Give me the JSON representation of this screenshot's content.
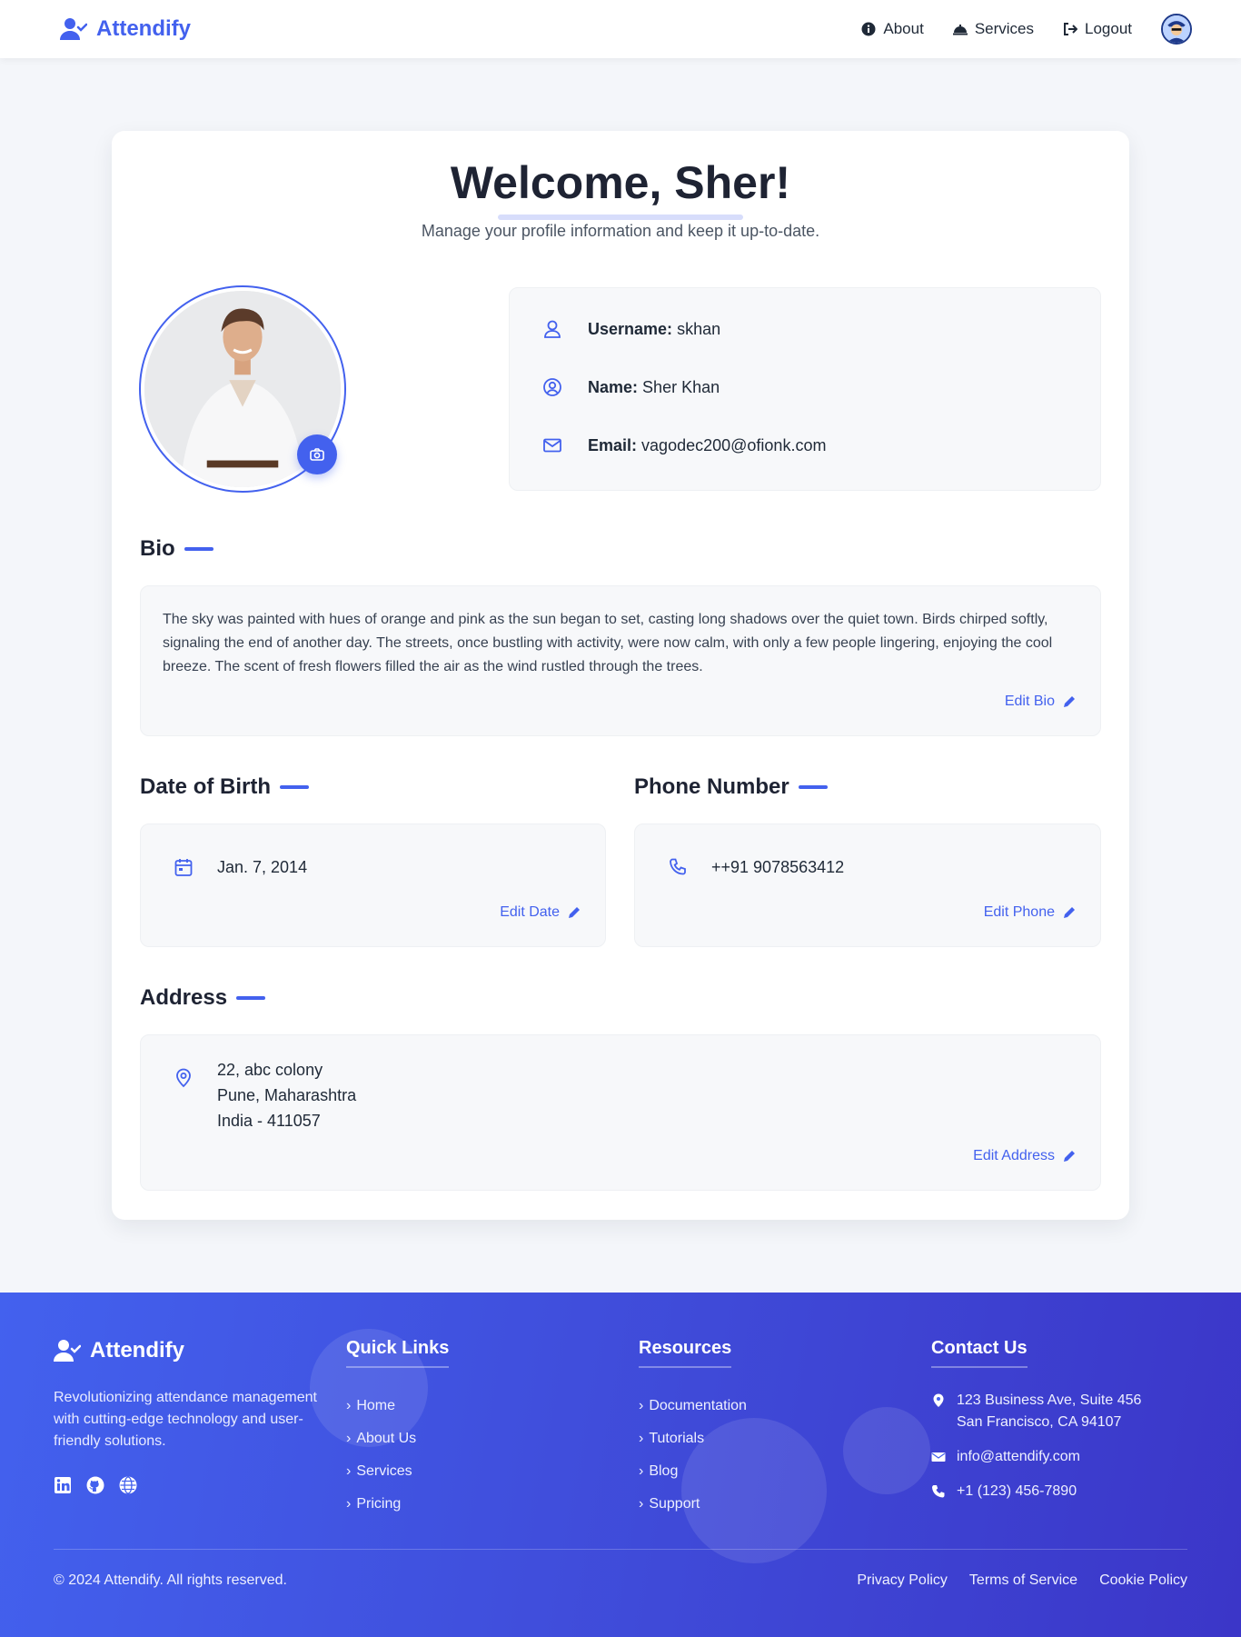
{
  "nav": {
    "brand": "Attendify",
    "links": [
      {
        "label": "About",
        "icon": "info-icon"
      },
      {
        "label": "Services",
        "icon": "service-bell-icon"
      },
      {
        "label": "Logout",
        "icon": "logout-icon"
      }
    ]
  },
  "colors": {
    "accent": "#4361ee",
    "footer_start": "#4361ee",
    "footer_end": "#3b36c8"
  },
  "profile": {
    "welcome": "Welcome, Sher!",
    "subtitle": "Manage your profile information and keep it up-to-date.",
    "username_label": "Username:",
    "username": "skhan",
    "name_label": "Name:",
    "name": "Sher Khan",
    "email_label": "Email:",
    "email": "vagodec200@ofionk.com"
  },
  "bio": {
    "title": "Bio",
    "text": "The sky was painted with hues of orange and pink as the sun began to set, casting long shadows over the quiet town. Birds chirped softly, signaling the end of another day. The streets, once bustling with activity, were now calm, with only a few people lingering, enjoying the cool breeze. The scent of fresh flowers filled the air as the wind rustled through the trees.",
    "edit_label": "Edit Bio"
  },
  "dob": {
    "title": "Date of Birth",
    "value": "Jan. 7, 2014",
    "edit_label": "Edit Date"
  },
  "phone": {
    "title": "Phone Number",
    "value": "++91 9078563412",
    "edit_label": "Edit Phone"
  },
  "address": {
    "title": "Address",
    "line1": "22, abc colony",
    "line2": "Pune, Maharashtra",
    "line3": "India - 411057",
    "edit_label": "Edit Address"
  },
  "footer": {
    "brand": "Attendify",
    "description": "Revolutionizing attendance management with cutting-edge technology and user-friendly solutions.",
    "quick_links": {
      "title": "Quick Links",
      "items": [
        "Home",
        "About Us",
        "Services",
        "Pricing"
      ]
    },
    "resources": {
      "title": "Resources",
      "items": [
        "Documentation",
        "Tutorials",
        "Blog",
        "Support"
      ]
    },
    "contact": {
      "title": "Contact Us",
      "address_line1": "123 Business Ave, Suite 456",
      "address_line2": "San Francisco, CA 94107",
      "email": "info@attendify.com",
      "phone": "+1 (123) 456-7890"
    },
    "copyright": "© 2024 Attendify. All rights reserved.",
    "legal": [
      "Privacy Policy",
      "Terms of Service",
      "Cookie Policy"
    ]
  }
}
